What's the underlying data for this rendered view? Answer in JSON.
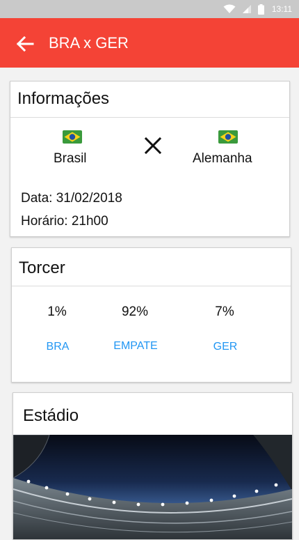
{
  "status_bar": {
    "time": "13:11",
    "icons": [
      "wifi-icon",
      "signal-icon",
      "battery-icon"
    ]
  },
  "app_bar": {
    "title": "BRA x GER",
    "back_icon": "arrow-back-icon"
  },
  "info_card": {
    "title": "Informações",
    "home_team": {
      "name": "Brasil",
      "flag": "brazil-flag"
    },
    "away_team": {
      "name": "Alemanha",
      "flag": "brazil-flag"
    },
    "date_line": "Data: 31/02/2018",
    "time_line": "Horário: 21h00"
  },
  "torcer_card": {
    "title": "Torcer",
    "options": [
      {
        "percent": "1%",
        "label": "BRA"
      },
      {
        "percent": "92%",
        "label": "EMPATE"
      },
      {
        "percent": "7%",
        "label": "GER"
      }
    ]
  },
  "stadium_card": {
    "title": "Estádio",
    "image": "stadium-photo"
  },
  "colors": {
    "app_bar": "#f44336",
    "accent": "#2196f3",
    "status_bar": "#c9c9c9"
  }
}
